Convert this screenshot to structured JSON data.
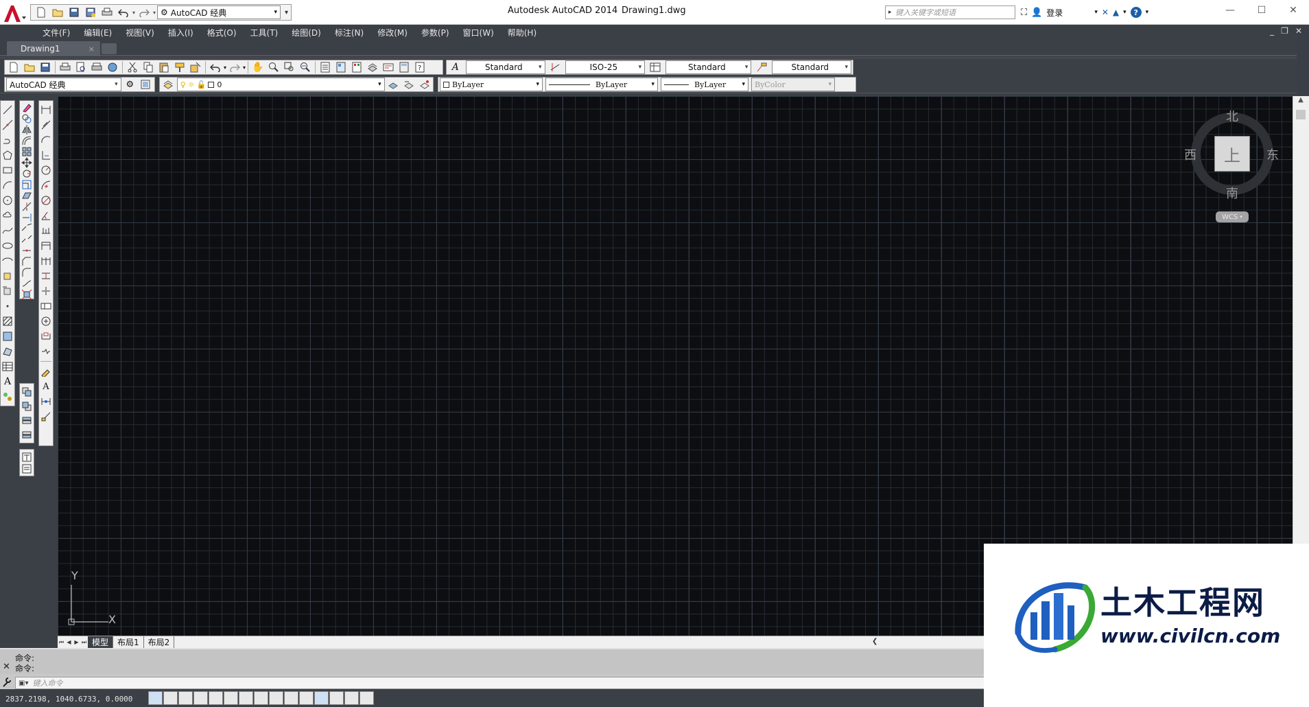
{
  "app": {
    "workspace": "AutoCAD 经典",
    "product": "Autodesk AutoCAD 2014",
    "document": "Drawing1.dwg",
    "search_placeholder": "键入关键字或短语",
    "login_label": "登录",
    "help_label": "?"
  },
  "menu": {
    "items": [
      "文件(F)",
      "编辑(E)",
      "视图(V)",
      "插入(I)",
      "格式(O)",
      "工具(T)",
      "绘图(D)",
      "标注(N)",
      "修改(M)",
      "参数(P)",
      "窗口(W)",
      "帮助(H)"
    ]
  },
  "file_tab": {
    "label": "Drawing1",
    "close": "×"
  },
  "toolbar": {
    "text_style": "Standard",
    "dim_style": "ISO-25",
    "table_style": "Standard",
    "mleader_style": "Standard",
    "workspace": "AutoCAD 经典",
    "layer": "0",
    "color": "ByLayer",
    "linetype": "ByLayer",
    "lineweight": "ByLayer",
    "plotstyle": "ByColor"
  },
  "viewcube": {
    "north": "北",
    "south": "南",
    "east": "东",
    "west": "西",
    "face": "上",
    "wcs": "WCS"
  },
  "ucs": {
    "x_label": "X",
    "y_label": "Y"
  },
  "layout_tabs": [
    "模型",
    "布局1",
    "布局2"
  ],
  "command": {
    "history": [
      "命令:",
      "命令:"
    ],
    "placeholder": "键入命令"
  },
  "status": {
    "coordinates": "2837.2198,  1040.6733,  0.0000"
  },
  "watermark": {
    "chinese": "土木工程网",
    "url": "www.civilcn.com"
  },
  "colors": {
    "chrome": "#3b3f46",
    "canvas": "#0c0e11",
    "logo_red": "#c8102e",
    "watermark_blue": "#1f5fbf",
    "watermark_green": "#3aa935"
  }
}
